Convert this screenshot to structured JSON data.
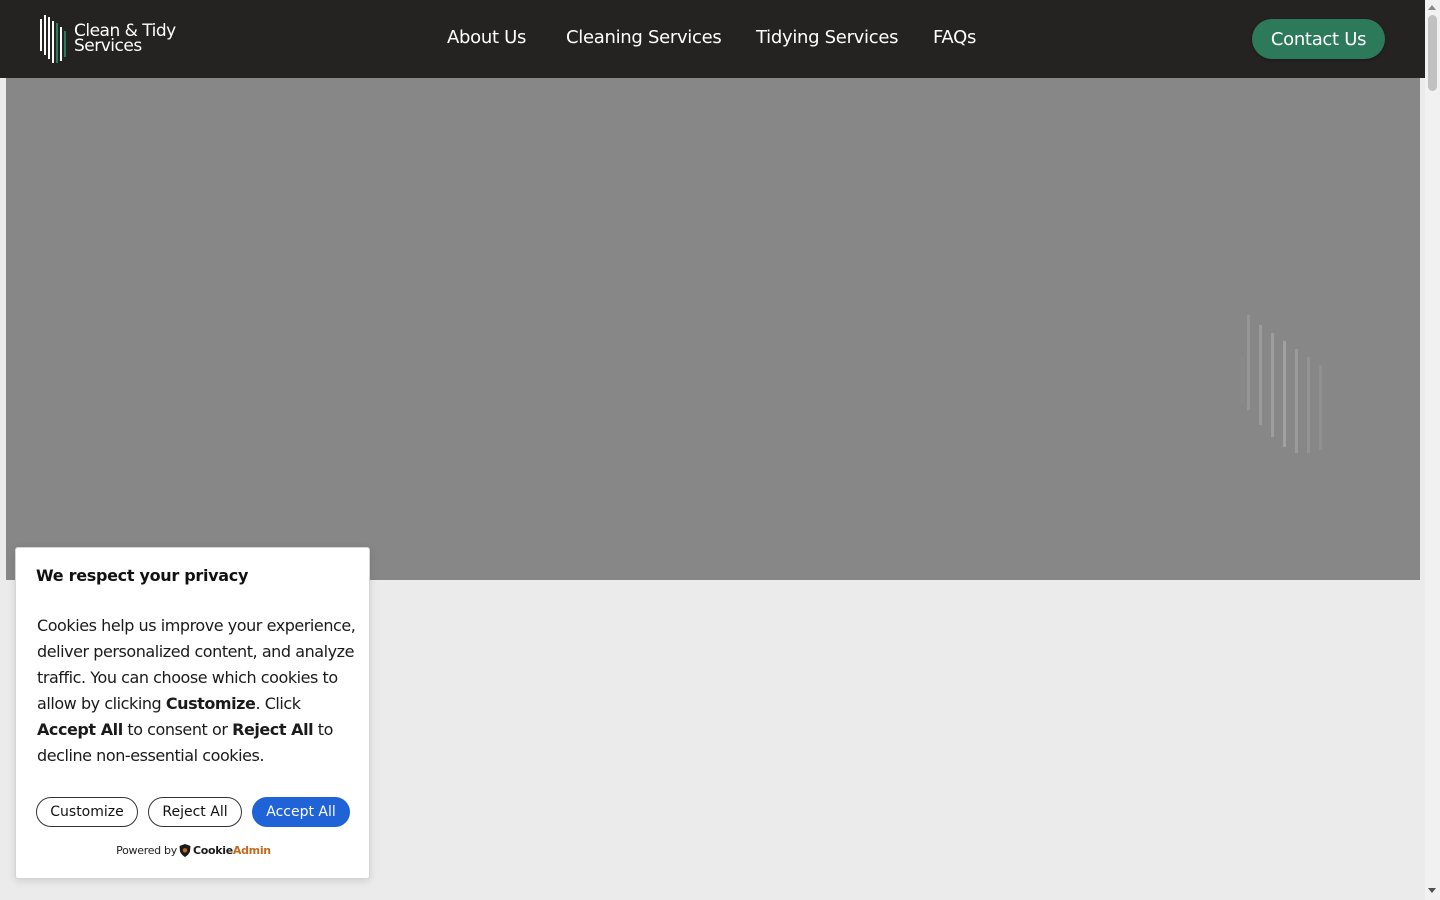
{
  "brand": {
    "logo_line1": "Clean & Tidy",
    "logo_line2": "Services"
  },
  "nav": {
    "items": [
      {
        "label": "About Us"
      },
      {
        "label": "Cleaning Services"
      },
      {
        "label": "Tidying Services"
      },
      {
        "label": "FAQs"
      }
    ],
    "contact_label": "Contact Us"
  },
  "cookie_banner": {
    "title": "We respect your privacy",
    "body_part1": "Cookies help us improve your experience, deliver personalized content, and analyze traffic. You can choose which cookies to allow by clicking ",
    "body_customize": "Customize",
    "body_part2": ". Click ",
    "body_accept": "Accept All",
    "body_part3": " to consent or ",
    "body_reject": "Reject All",
    "body_part4": " to decline non-essential cookies.",
    "customize_label": "Customize",
    "reject_label": "Reject All",
    "accept_label": "Accept All",
    "powered_by": "Powered by",
    "powered_brand_a": "Cookie",
    "powered_brand_b": "Admin"
  },
  "colors": {
    "header_bg": "#252222",
    "contact_green": "#2c7a5a",
    "hero_gray": "#878787",
    "accept_blue": "#1f63d6",
    "page_bg": "#ebebeb"
  },
  "icons": {
    "logo": "stripes-logo-icon",
    "loader": "stripes-loader-icon",
    "powered": "shield-icon"
  }
}
